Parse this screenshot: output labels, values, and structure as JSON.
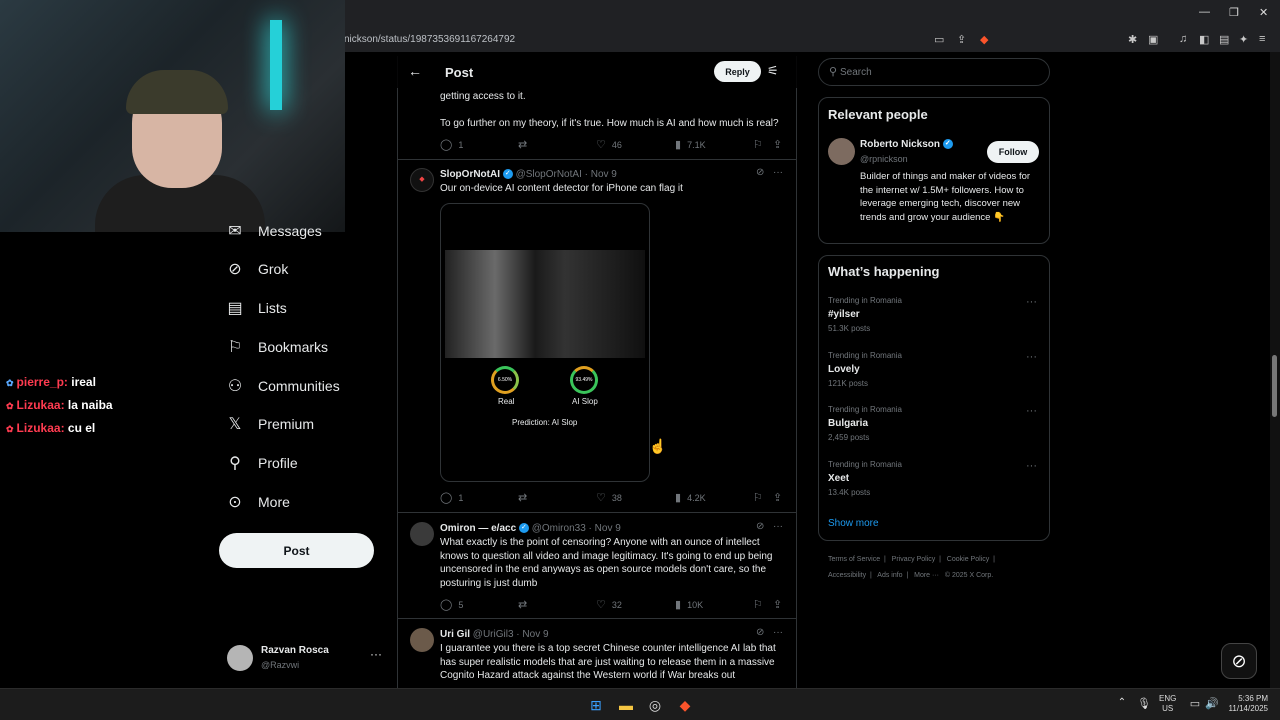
{
  "browser": {
    "url": "nickson/status/1987353691167264792"
  },
  "chat": [
    {
      "user": "pierre_p:",
      "msg": "ireal"
    },
    {
      "user": "Lizukaa:",
      "msg": "la naiba"
    },
    {
      "user": "Lizukaa:",
      "msg": "cu el"
    }
  ],
  "sidebar": {
    "items": [
      {
        "label": "Messages",
        "icon": "envelope-icon"
      },
      {
        "label": "Grok",
        "icon": "grok-icon"
      },
      {
        "label": "Lists",
        "icon": "list-icon"
      },
      {
        "label": "Bookmarks",
        "icon": "bookmark-icon"
      },
      {
        "label": "Communities",
        "icon": "communities-icon"
      },
      {
        "label": "Premium",
        "icon": "x-icon"
      },
      {
        "label": "Profile",
        "icon": "person-icon"
      },
      {
        "label": "More",
        "icon": "more-icon"
      }
    ],
    "post_label": "Post",
    "account": {
      "name": "Razvan Rosca",
      "handle": "@Razvwi"
    }
  },
  "header": {
    "title": "Post",
    "reply_label": "Reply"
  },
  "tweets": [
    {
      "text1": "getting access to it.",
      "text2": "To go further on my theory, if it's true. How much is AI and how much is real?",
      "replies": "1",
      "likes": "46",
      "views": "7.1K"
    },
    {
      "name": "SlopOrNotAI",
      "handle": "@SlopOrNotAI",
      "date": "· Nov 9",
      "text": "Our on-device AI content detector for iPhone can flag it",
      "media": {
        "real_pct": "6.50%",
        "real_label": "Real",
        "ai_pct": "93.49%",
        "ai_label": "AI Slop",
        "prediction": "Prediction: AI Slop"
      },
      "replies": "1",
      "likes": "38",
      "views": "4.2K"
    },
    {
      "name": "Omiron — e/acc",
      "handle": "@Omiron33",
      "date": "· Nov 9",
      "text": "What exactly is the point of censoring? Anyone with an ounce of intellect knows to question all video and image legitimacy.  It's going to end up being uncensored in the end anyways as open source models don't care, so the posturing is just dumb",
      "replies": "5",
      "likes": "32",
      "views": "10K"
    },
    {
      "name": "Uri Gil",
      "handle": "@UriGil3",
      "date": "· Nov 9",
      "text": "I guarantee you there is a top secret Chinese counter intelligence AI lab that has super realistic models that are just waiting to release them in a massive Cognito Hazard attack against the Western world if War breaks out"
    }
  ],
  "search": {
    "placeholder": "Search"
  },
  "relevant": {
    "title": "Relevant people",
    "name": "Roberto Nickson",
    "handle": "@rpnickson",
    "follow_label": "Follow",
    "bio": "Builder of things and maker of videos for the internet w/ 1.5M+ followers. How to leverage emerging tech, discover new trends and grow your audience 👇"
  },
  "happening": {
    "title": "What’s happening",
    "trends": [
      {
        "cat": "Trending in Romania",
        "name": "#yilser",
        "count": "51.3K posts"
      },
      {
        "cat": "Trending in Romania",
        "name": "Lovely",
        "count": "121K posts"
      },
      {
        "cat": "Trending in Romania",
        "name": "Bulgaria",
        "count": "2,459 posts"
      },
      {
        "cat": "Trending in Romania",
        "name": "Xeet",
        "count": "13.4K posts"
      }
    ],
    "show_more": "Show more"
  },
  "footer": {
    "links1": [
      "Terms of Service",
      "Privacy Policy",
      "Cookie Policy"
    ],
    "links2": [
      "Accessibility",
      "Ads info",
      "More ···"
    ],
    "copyright": "© 2025 X Corp."
  },
  "taskbar": {
    "lang1": "ENG",
    "lang2": "US",
    "time": "5:36 PM",
    "date": "11/14/2025"
  }
}
